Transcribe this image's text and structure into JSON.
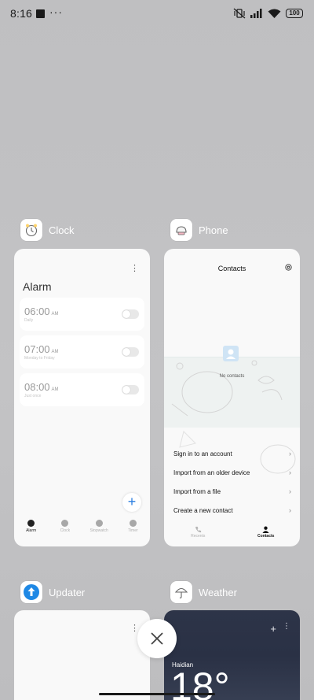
{
  "status_bar": {
    "time": "8:16",
    "overflow": "···",
    "battery": "100"
  },
  "apps": {
    "clock": {
      "name": "Clock",
      "title": "Alarm",
      "alarms": [
        {
          "time": "06:00",
          "ampm": "AM",
          "repeat": "Daily"
        },
        {
          "time": "07:00",
          "ampm": "AM",
          "repeat": "Monday to Friday"
        },
        {
          "time": "08:00",
          "ampm": "AM",
          "repeat": "Just once"
        }
      ],
      "add_symbol": "+",
      "nav": [
        "Alarm",
        "Clock",
        "Stopwatch",
        "Timer"
      ]
    },
    "phone": {
      "name": "Phone",
      "title": "Contacts",
      "empty_text": "No contacts",
      "actions": [
        "Sign in to an account",
        "Import from an older device",
        "Import from a file",
        "Create a new contact"
      ],
      "nav": [
        "Recents",
        "Contacts"
      ]
    },
    "updater": {
      "name": "Updater"
    },
    "weather": {
      "name": "Weather",
      "city": "Haidian",
      "temp": "18°",
      "add_symbol": "+"
    }
  },
  "colors": {
    "background": "#c0c0c2",
    "card": "#f9f9f9",
    "accent_blue": "#2a7ee0",
    "weather_bg": "#2d3448"
  }
}
